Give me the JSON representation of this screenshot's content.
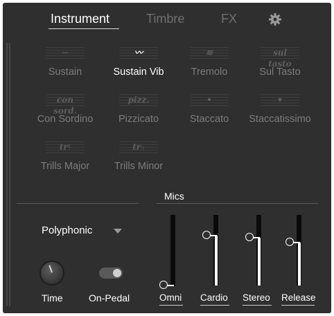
{
  "tabs": {
    "instrument": "Instrument",
    "timbre": "Timbre",
    "fx": "FX",
    "settings_icon": "gear-icon"
  },
  "articulations": [
    {
      "label": "Sustain",
      "glyph": "−",
      "active": false
    },
    {
      "label": "Sustain Vib",
      "glyph": "〰",
      "active": true
    },
    {
      "label": "Tremolo",
      "glyph": "≋",
      "active": false
    },
    {
      "label": "Sul Tasto",
      "glyph": "sul tasto",
      "active": false
    },
    {
      "label": "Con Sordino",
      "glyph": "con sord.",
      "active": false
    },
    {
      "label": "Pizzicato",
      "glyph": "pizz.",
      "active": false
    },
    {
      "label": "Staccato",
      "glyph": "•",
      "active": false
    },
    {
      "label": "Staccatissimo",
      "glyph": "▾",
      "active": false
    },
    {
      "label": "Trills Major",
      "glyph": "tr♮",
      "active": false
    },
    {
      "label": "Trills Minor",
      "glyph": "tr♭",
      "active": false
    }
  ],
  "mics": {
    "title": "Mics",
    "channels": [
      {
        "label": "Omni",
        "level": 0.0
      },
      {
        "label": "Cardio",
        "level": 0.71
      },
      {
        "label": "Stereo",
        "level": 0.68
      },
      {
        "label": "Release",
        "level": 0.61
      }
    ]
  },
  "controls": {
    "voice_mode": "Polyphonic",
    "time_label": "Time",
    "on_pedal_label": "On-Pedal",
    "on_pedal_enabled": true
  },
  "colors": {
    "background": "#2f2f2f",
    "active_text": "#ffffff",
    "inactive_text": "#7c7c7c"
  }
}
